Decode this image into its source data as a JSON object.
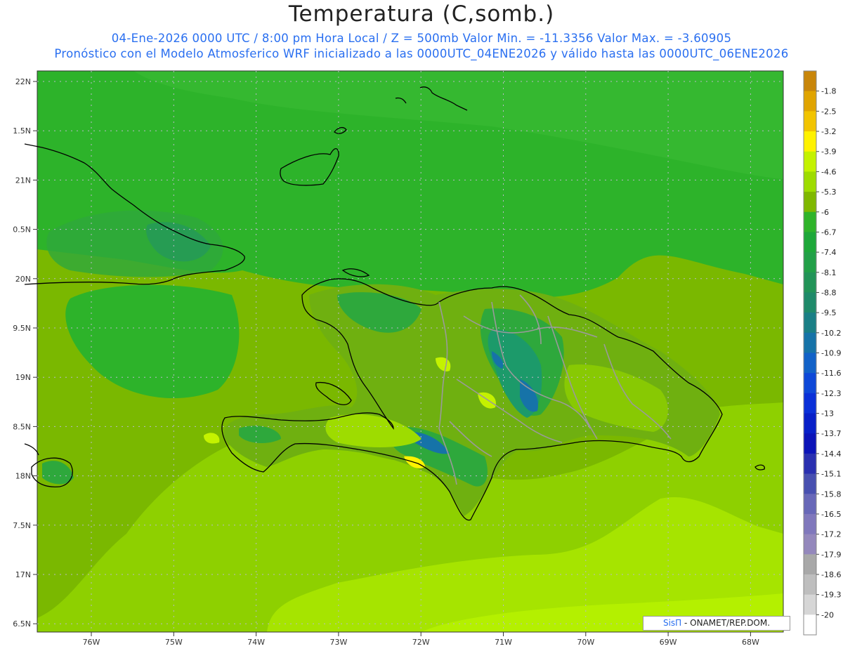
{
  "header": {
    "title": "Temperatura (C,somb.)",
    "line1": "04-Ene-2026  0000 UTC / 8:00 pm Hora Local / Z = 500mb  Valor Min. = -11.3356  Valor Max. = -3.60905",
    "line2": "Pronóstico con el Modelo Atmosferico WRF inicializado a las 0000UTC_04ENE2026 y válido hasta las  0000UTC_06ENE2026"
  },
  "axes": {
    "lat_labels": [
      "22N",
      "1.5N",
      "21N",
      "0.5N",
      "20N",
      "9.5N",
      "19N",
      "8.5N",
      "18N",
      "7.5N",
      "17N",
      "6.5N"
    ],
    "lon_labels": [
      "76W",
      "75W",
      "74W",
      "73W",
      "72W",
      "71W",
      "70W",
      "69W",
      "68W"
    ]
  },
  "colorbar": {
    "labels": [
      "-1.8",
      "-2.5",
      "-3.2",
      "-3.9",
      "-4.6",
      "-5.3",
      "-6",
      "-6.7",
      "-7.4",
      "-8.1",
      "-8.8",
      "-9.5",
      "-10.2",
      "-10.9",
      "-11.6",
      "-12.3",
      "-13",
      "-13.7",
      "-14.4",
      "-15.1",
      "-15.8",
      "-16.5",
      "-17.2",
      "-17.9",
      "-18.6",
      "-19.3",
      "-20"
    ],
    "colors": [
      "#c8860a",
      "#e0a400",
      "#f2c400",
      "#fff200",
      "#c4f200",
      "#9edc00",
      "#7fb800",
      "#2fb42a",
      "#1ea83a",
      "#22a048",
      "#229458",
      "#1f8a6a",
      "#1a7f86",
      "#1673a8",
      "#1262c8",
      "#0e48d8",
      "#0a30d8",
      "#0820c8",
      "#0c14b8",
      "#2a30b0",
      "#4850b0",
      "#6868b8",
      "#8078bc",
      "#9488bc",
      "#a8a8a8",
      "#bebebe",
      "#d6d6d6",
      "#ffffff"
    ]
  },
  "credit": {
    "logo": "SisΠ",
    "text": " - ONAMET/REP.DOM."
  }
}
